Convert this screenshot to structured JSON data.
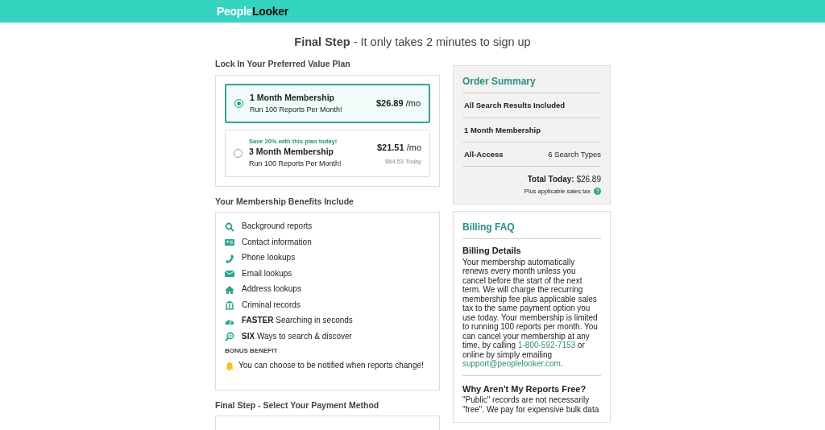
{
  "header": {
    "logo_first": "People",
    "logo_second": "Looker"
  },
  "page_title": {
    "bold": "Final Step",
    "rest": " - It only takes 2 minutes to sign up"
  },
  "plans_heading": "Lock In Your Preferred Value Plan",
  "plans": [
    {
      "selected": true,
      "title": "1 Month Membership",
      "subtitle": "Run 100 Reports Per Month!",
      "price": "$26.89",
      "per": "/mo"
    },
    {
      "selected": false,
      "promo": "Save 20% with this plan today!",
      "title": "3 Month Membership",
      "subtitle": "Run 100 Reports Per Month!",
      "price": "$21.51",
      "per": "/mo",
      "today": "$64.53 Today"
    }
  ],
  "benefits_heading": "Your Membership Benefits Include",
  "benefits": [
    {
      "kind": "search",
      "text": "Background reports"
    },
    {
      "kind": "card",
      "text": "Contact information"
    },
    {
      "kind": "phone",
      "text": "Phone lookups"
    },
    {
      "kind": "mail",
      "text": "Email lookups"
    },
    {
      "kind": "home",
      "text": "Address lookups"
    },
    {
      "kind": "bank",
      "text": "Criminal records"
    },
    {
      "kind": "gauge",
      "text": "**FASTER** Searching in seconds"
    },
    {
      "kind": "zoom",
      "text": "**SIX** Ways to search & discover"
    }
  ],
  "bonus_label": "BONUS BENEFIT",
  "bonus_text": "You can choose to be notified when reports change!",
  "payment_heading": "Final Step - Select Your Payment Method",
  "summary": {
    "title": "Order Summary",
    "rows": [
      {
        "label": "All Search Results Included"
      },
      {
        "label": "1 Month Membership"
      },
      {
        "label": "All-Access",
        "value": "6 Search Types"
      }
    ],
    "total_label": "Total Today:",
    "total_value": "$26.89",
    "tax_note": "Plus applicable sales tax"
  },
  "faq": {
    "title": "Billing FAQ",
    "sections": [
      {
        "question": "Billing Details",
        "text": "Your membership automatically renews every month unless you cancel before the start of the next term. We will charge the recurring membership fee plus applicable sales tax to the same payment option you use today. Your membership is limited to running 100 reports per month. You can cancel your membership at any time, by calling ",
        "phone": "1-800-592-7153",
        "middle": " or online by simply emailing ",
        "email": "support@peoplelooker.com",
        "end": "."
      },
      {
        "question": "Why Aren't My Reports Free?",
        "text": "\"Public\" records are not necessarily \"free\". We pay for expensive bulk data"
      }
    ]
  }
}
